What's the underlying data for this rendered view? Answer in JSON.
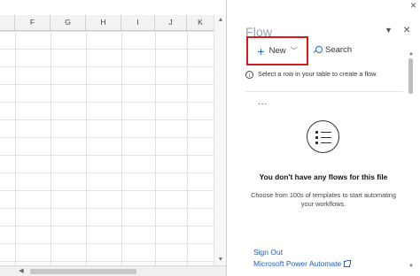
{
  "sheet": {
    "columns": [
      "F",
      "G",
      "H",
      "I",
      "J",
      "K"
    ]
  },
  "pane": {
    "title": "Flow",
    "new_label": "New",
    "search_label": "Search",
    "info_text": "Select a row in your table to create a flow.",
    "more": "...",
    "empty_title": "You don't have any flows for this file",
    "empty_desc": "Choose from 100s of templates to start automating your workflows.",
    "sign_out": "Sign Out",
    "power_automate_link": "Microsoft Power Automate",
    "highlight_color": "#d31b1b",
    "accent_color": "#1f6fd1"
  }
}
